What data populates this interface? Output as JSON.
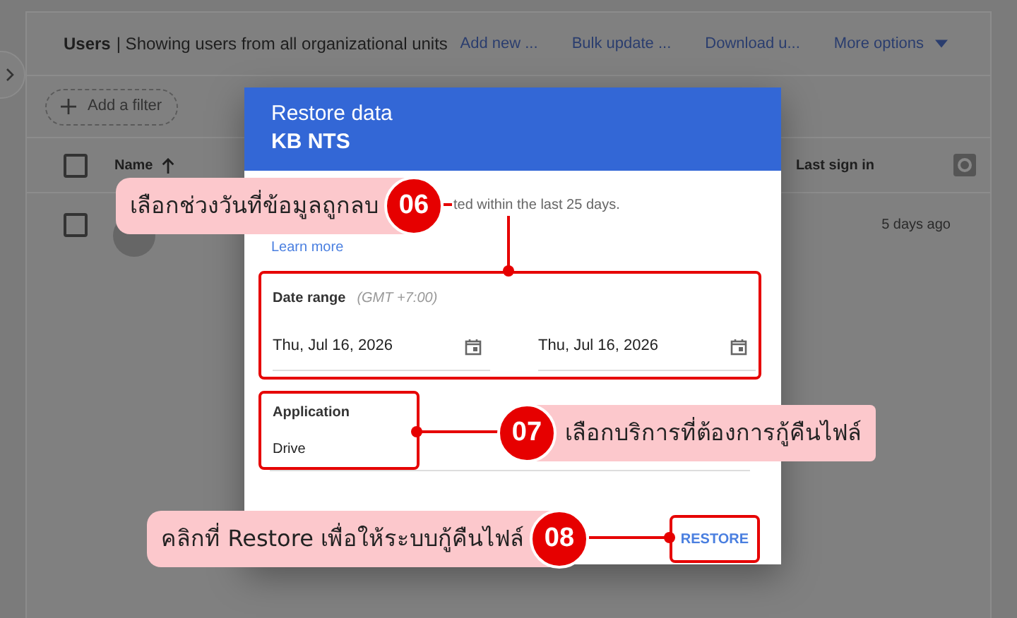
{
  "header": {
    "title": "Users",
    "subtitle": "| Showing users from all organizational units",
    "actions": [
      {
        "label": "Add new ...",
        "has_menu": false
      },
      {
        "label": "Bulk update ...",
        "has_menu": false
      },
      {
        "label": "Download u...",
        "has_menu": false
      },
      {
        "label": "More options",
        "has_menu": true
      }
    ]
  },
  "filter_button": {
    "label": "Add a filter"
  },
  "table": {
    "select_all": {
      "checked": false
    },
    "columns": [
      {
        "label": "Name",
        "sorted": true
      },
      {
        "label": "Last sign in",
        "sorted": false
      }
    ],
    "rows": [
      {
        "checked": false,
        "last_sign_in": "5 days ago"
      }
    ]
  },
  "dialog": {
    "title": "Restore data",
    "subtitle": "KB NTS",
    "description": "ted within the last 25 days.",
    "link": "Learn more",
    "date_range": {
      "label": "Date range",
      "timezone": "(GMT +7:00)",
      "from": "Thu, Jul 16, 2026",
      "to": "Thu, Jul 16, 2026",
      "highlighted": true
    },
    "application": {
      "label": "Application",
      "value": "Drive",
      "highlighted": true
    },
    "action": {
      "label": "RESTORE",
      "highlighted": true
    }
  },
  "callouts": [
    {
      "number": "06",
      "text": "เลือกช่วงวันที่ข้อมูลถูกลบ"
    },
    {
      "number": "07",
      "text": "เลือกบริการที่ต้องการกู้คืนไฟล์"
    },
    {
      "number": "08",
      "text": "คลิกที่ Restore เพื่อให้ระบบกู้คืนไฟล์"
    }
  ]
}
